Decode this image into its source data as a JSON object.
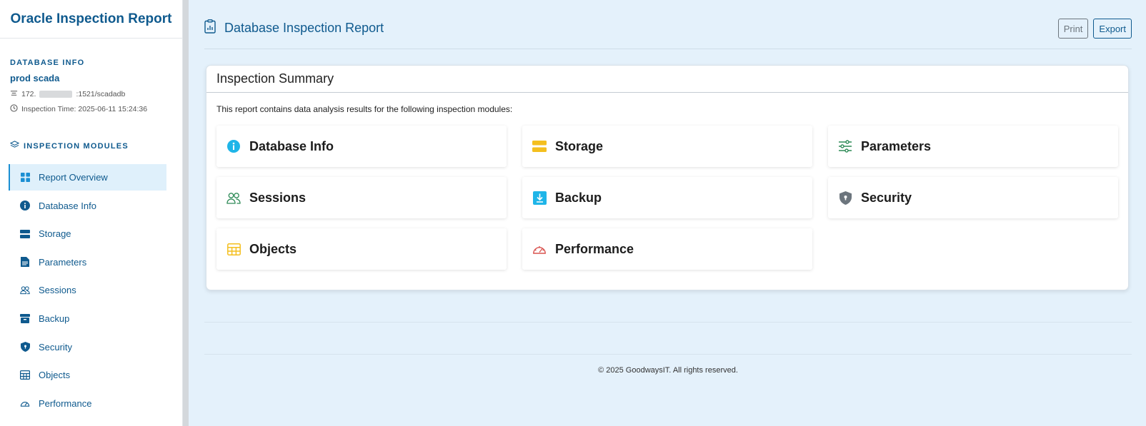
{
  "sidebar": {
    "title": "Oracle Inspection Report",
    "db_info_title": "DATABASE INFO",
    "db_name": "prod scada",
    "connection_prefix": "172.",
    "connection_suffix": ":1521/scadadb",
    "inspection_time": "Inspection Time: 2025-06-11 15:24:36",
    "modules_title": "INSPECTION MODULES",
    "items": [
      {
        "label": "Report Overview",
        "icon": "grid-icon",
        "active": true
      },
      {
        "label": "Database Info",
        "icon": "info-icon"
      },
      {
        "label": "Storage",
        "icon": "storage-icon"
      },
      {
        "label": "Parameters",
        "icon": "document-icon"
      },
      {
        "label": "Sessions",
        "icon": "people-icon"
      },
      {
        "label": "Backup",
        "icon": "archive-icon"
      },
      {
        "label": "Security",
        "icon": "shield-icon"
      },
      {
        "label": "Objects",
        "icon": "table-icon"
      },
      {
        "label": "Performance",
        "icon": "speedometer-icon"
      }
    ]
  },
  "header": {
    "title": "Database Inspection Report",
    "print_label": "Print",
    "export_label": "Export"
  },
  "summary": {
    "title": "Inspection Summary",
    "description": "This report contains data analysis results for the following inspection modules:",
    "modules": [
      {
        "label": "Database Info",
        "icon": "info-icon",
        "color": "#1fb5e8"
      },
      {
        "label": "Storage",
        "icon": "storage-icon",
        "color": "#f4bf1f"
      },
      {
        "label": "Parameters",
        "icon": "sliders-icon",
        "color": "#2e8b57"
      },
      {
        "label": "Sessions",
        "icon": "people-icon",
        "color": "#2e8b57"
      },
      {
        "label": "Backup",
        "icon": "download-icon",
        "color": "#1fb5e8"
      },
      {
        "label": "Security",
        "icon": "shield-icon",
        "color": "#6c757d"
      },
      {
        "label": "Objects",
        "icon": "table-icon",
        "color": "#f4bf1f"
      },
      {
        "label": "Performance",
        "icon": "speedometer-icon",
        "color": "#d9534f"
      }
    ]
  },
  "footer": {
    "text": "© 2025 GoodwaysIT. All rights reserved."
  },
  "colors": {
    "brand": "#0f5a8e",
    "background": "#e4f1fb",
    "active_bg": "#dff0fb"
  }
}
